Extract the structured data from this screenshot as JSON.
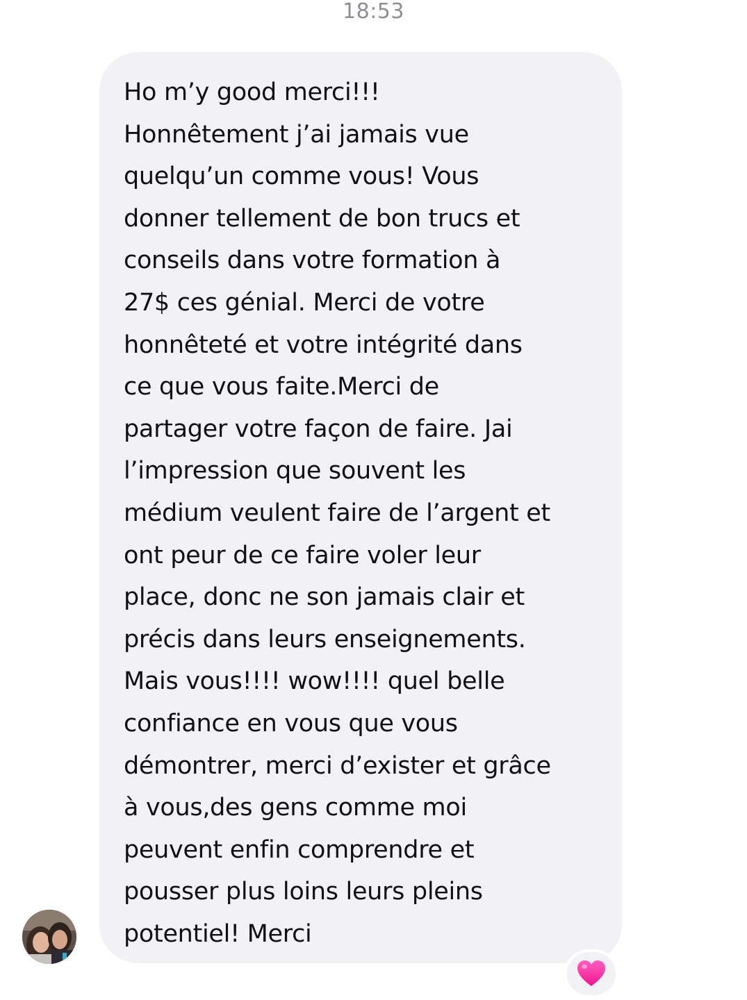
{
  "conversation": {
    "timestamp": "18:53"
  },
  "message": {
    "text": "Ho m’y good merci!!!\nHonnêtement j’ai jamais vue\nquelqu’un comme vous! Vous\ndonner tellement de bon trucs et\nconseils dans votre formation à\n27$ ces génial. Merci de votre\nhonnêteté et votre intégrité dans\nce que vous faite.Merci de\npartager votre façon de faire. Jai\nl’impression que souvent les\nmédium veulent faire de l’argent et\nont peur de ce faire voler leur\nplace, donc ne son jamais clair et\nprécis dans leurs enseignements.\nMais vous!!!! wow!!!! quel belle\nconfiance en vous que vous\ndémontrer, merci d’exister et grâce\nà vous,des gens comme moi\npeuvent enfin comprendre et\npousser plus loins leurs pleins\npotentiel! Merci",
    "reaction_icon": "pink-heart-icon",
    "reaction_color": "#ff2fa0"
  },
  "sender": {
    "avatar_icon": "sender-avatar-photo"
  },
  "colors": {
    "bubble_background": "#f1f1f6",
    "timestamp_text": "#8e8e93",
    "message_text": "#111111"
  }
}
